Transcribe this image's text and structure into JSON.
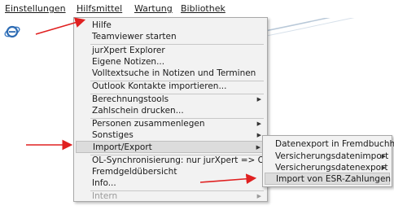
{
  "menubar": {
    "items": [
      "Einstellungen",
      "Hilfsmittel",
      "Wartung",
      "Bibliothek"
    ]
  },
  "menu": {
    "items": [
      {
        "label": "Hilfe"
      },
      {
        "label": "Teamviewer starten"
      },
      {
        "label": "jurXpert Explorer"
      },
      {
        "label": "Eigene Notizen..."
      },
      {
        "label": "Volltextsuche in Notizen und Terminen"
      },
      {
        "label": "Outlook Kontakte importieren..."
      },
      {
        "label": "Berechnungstools",
        "submenu": true
      },
      {
        "label": "Zahlschein drucken..."
      },
      {
        "label": "Personen zusammenlegen",
        "submenu": true
      },
      {
        "label": "Sonstiges",
        "submenu": true
      },
      {
        "label": "Import/Export",
        "submenu": true,
        "highlighted": true
      },
      {
        "label": "OL-Synchronisierung: nur jurXpert => Outlo..."
      },
      {
        "label": "Fremdgeldübersicht"
      },
      {
        "label": "Info..."
      },
      {
        "label": "Intern",
        "submenu": true,
        "disabled": true
      }
    ]
  },
  "submenu": {
    "items": [
      {
        "label": "Datenexport in Fremdbuchhal..."
      },
      {
        "label": "Versicherungsdatenimport",
        "submenu": true
      },
      {
        "label": "Versicherungsdatenexport",
        "submenu": true
      },
      {
        "label": "Import von ESR-Zahlungen",
        "highlighted": true
      }
    ]
  },
  "colors": {
    "arrow": "#e02020",
    "swoosh": "#b8c8d8",
    "highlight": "#dcdcdc"
  }
}
